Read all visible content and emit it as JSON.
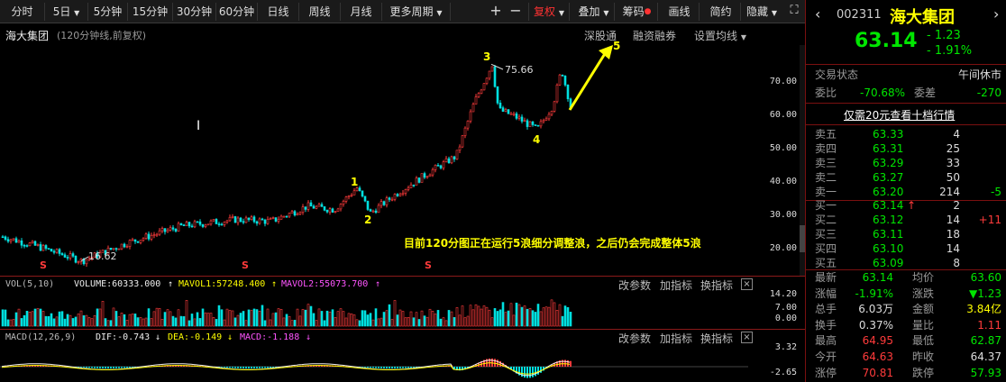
{
  "toolbar": {
    "periods": [
      "分时",
      "5日",
      "5分钟",
      "15分钟",
      "30分钟",
      "60分钟",
      "日线",
      "周线",
      "月线",
      "更多周期"
    ],
    "right": [
      "复权",
      "叠加",
      "筹码",
      "画线",
      "简约",
      "隐藏"
    ],
    "plus": "+",
    "minus": "−"
  },
  "chart": {
    "stock_name": "海大集团",
    "period_note": "(120分钟线,前复权)",
    "links": [
      "深股通",
      "融资融券",
      "设置均线"
    ],
    "y_ticks": [
      "70.00",
      "60.00",
      "50.00",
      "40.00",
      "30.00",
      "20.00"
    ],
    "annotation": "目前120分图正在运行5浪细分调整浪，之后仍会完成整体5浪",
    "high_label": "75.66",
    "low_label": "16.62",
    "wave_labels": [
      "1",
      "2",
      "3",
      "4",
      "5"
    ],
    "cursor_mark": "I",
    "s_marks": [
      "S",
      "S",
      "S"
    ]
  },
  "volume": {
    "name": "VOL(5,10)",
    "volume_label": "VOLUME:60333.000",
    "mavol1_label": "MAVOL1:57248.400",
    "mavol2_label": "MAVOL2:55073.700",
    "y_ticks": [
      "14.20",
      "7.00",
      "0.00"
    ]
  },
  "macd": {
    "name": "MACD(12,26,9)",
    "dif_label": "DIF:-0.743",
    "dea_label": "DEA:-0.149",
    "macd_label": "MACD:-1.188",
    "y_ticks": [
      "3.32",
      "-2.65"
    ]
  },
  "panel_buttons": {
    "adjust": "改参数",
    "add": "加指标",
    "switch": "换指标",
    "close": "×"
  },
  "quote": {
    "code": "002311",
    "name": "海大集团",
    "price": "63.14",
    "change": "- 1.23",
    "change_pct": "- 1.91%",
    "status_label": "交易状态",
    "status": "午间休市",
    "wb_label": "委比",
    "wb": "-70.68%",
    "wc_label": "委差",
    "wc": "-270",
    "promo": "仅需20元查看十档行情"
  },
  "sells": [
    {
      "label": "卖五",
      "price": "63.33",
      "vol": "4",
      "chg": ""
    },
    {
      "label": "卖四",
      "price": "63.31",
      "vol": "25",
      "chg": ""
    },
    {
      "label": "卖三",
      "price": "63.29",
      "vol": "33",
      "chg": ""
    },
    {
      "label": "卖二",
      "price": "63.27",
      "vol": "50",
      "chg": ""
    },
    {
      "label": "卖一",
      "price": "63.20",
      "vol": "214",
      "chg": "-5"
    }
  ],
  "buys": [
    {
      "label": "买一",
      "price": "63.14",
      "vol": "2",
      "chg": ""
    },
    {
      "label": "买二",
      "price": "63.12",
      "vol": "14",
      "chg": "+11"
    },
    {
      "label": "买三",
      "price": "63.11",
      "vol": "18",
      "chg": ""
    },
    {
      "label": "买四",
      "price": "63.10",
      "vol": "14",
      "chg": ""
    },
    {
      "label": "买五",
      "price": "63.09",
      "vol": "8",
      "chg": ""
    }
  ],
  "buy_arrow": "↑",
  "stats": [
    {
      "l1": "最新",
      "v1": "63.14",
      "l2": "均价",
      "v2": "63.60"
    },
    {
      "l1": "涨幅",
      "v1": "-1.91%",
      "l2": "涨跌",
      "v2": "▼1.23"
    },
    {
      "l1": "总手",
      "v1": "6.03万",
      "l2": "金额",
      "v2": "3.84亿"
    },
    {
      "l1": "换手",
      "v1": "0.37%",
      "l2": "量比",
      "v2": "1.11"
    },
    {
      "l1": "最高",
      "v1": "64.95",
      "l2": "最低",
      "v2": "62.87"
    },
    {
      "l1": "今开",
      "v1": "64.63",
      "l2": "昨收",
      "v2": "64.37"
    },
    {
      "l1": "涨停",
      "v1": "70.81",
      "l2": "跌停",
      "v2": "57.93"
    }
  ],
  "colors": {
    "up": "#ff3b3b",
    "down": "#00e0e0",
    "accent": "#ffff00",
    "grid": "#7a1010"
  }
}
